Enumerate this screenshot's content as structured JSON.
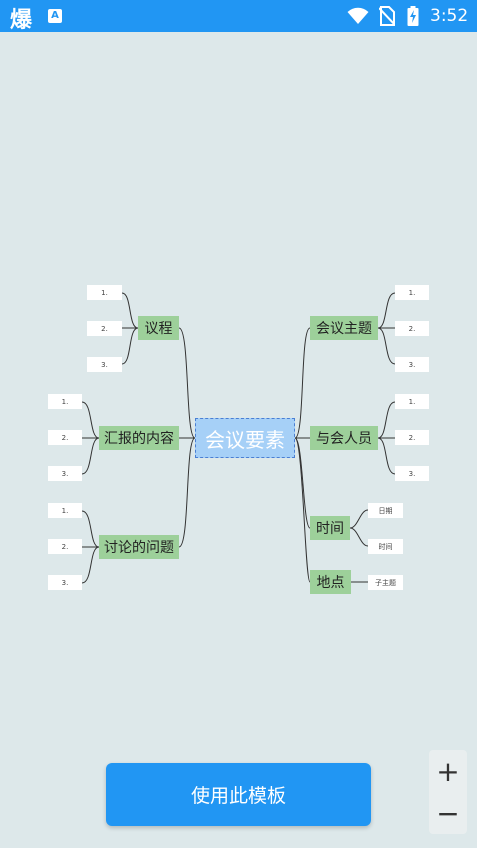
{
  "status_bar": {
    "app_icon_text": "爆",
    "app2_icon_text": "A",
    "time": "3:52"
  },
  "mindmap": {
    "central": "会议要素",
    "left_topics": [
      {
        "label": "议程",
        "leaves": [
          "1.",
          "2.",
          "3."
        ]
      },
      {
        "label": "汇报的内容",
        "leaves": [
          "1.",
          "2.",
          "3."
        ]
      },
      {
        "label": "讨论的问题",
        "leaves": [
          "1.",
          "2.",
          "3."
        ]
      }
    ],
    "right_topics": [
      {
        "label": "会议主题",
        "leaves": [
          "1.",
          "2.",
          "3."
        ]
      },
      {
        "label": "与会人员",
        "leaves": [
          "1.",
          "2.",
          "3."
        ]
      },
      {
        "label": "时间",
        "leaves": [
          "日期",
          "时间"
        ]
      },
      {
        "label": "地点",
        "leaves": [
          "子主题"
        ]
      }
    ]
  },
  "actions": {
    "use_template": "使用此模板",
    "zoom_in": "+",
    "zoom_out": "−"
  }
}
